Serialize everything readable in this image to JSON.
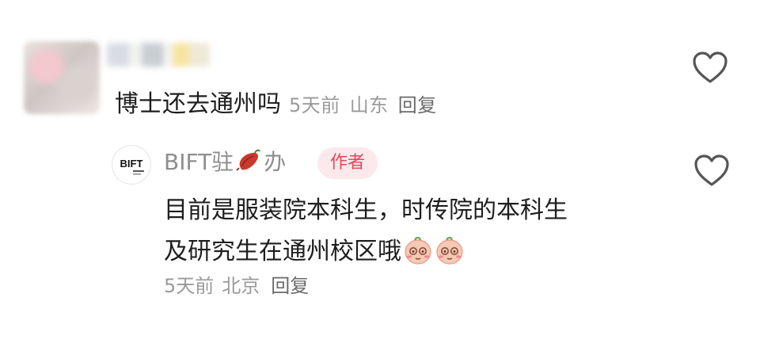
{
  "comment": {
    "text": "博士还去通州吗",
    "time": "5天前",
    "location": "山东",
    "reply_label": "回复",
    "icons": {
      "avatar": "blurred-avatar",
      "like": "heart-outline-icon"
    }
  },
  "reply": {
    "author_name_prefix": "BIFT驻",
    "author_name_suffix": "办",
    "author_avatar_text": "BIFT",
    "author_badge": "作者",
    "text_line_1": "目前是服装院本科生，时传院的本科生",
    "text_line_2": "及研究生在通州校区哦",
    "time": "5天前",
    "location": "北京",
    "reply_label": "回复",
    "icons": {
      "name_emoji": "sweet-potato-icon",
      "like": "heart-outline-icon",
      "text_emoji": "peach-face-emoji"
    }
  },
  "colors": {
    "text": "#1e1e1e",
    "meta": "#9a9a9a",
    "badge_bg": "#fbe9ec",
    "badge_text": "#e8465b"
  }
}
